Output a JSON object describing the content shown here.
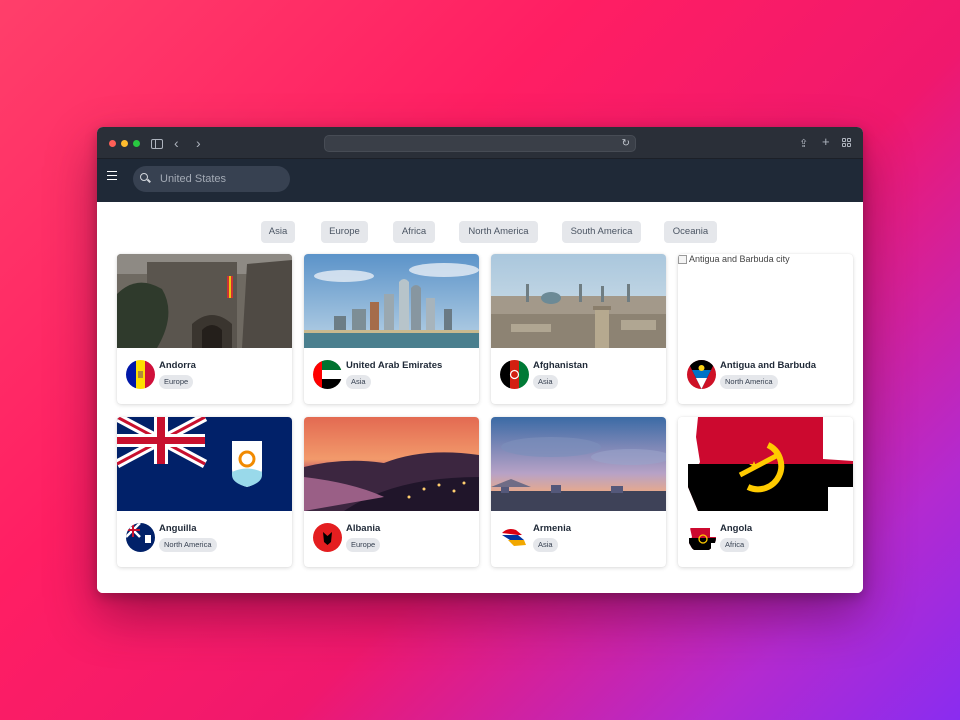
{
  "browser": {
    "url": ""
  },
  "search": {
    "placeholder": "United States"
  },
  "filters": [
    "Asia",
    "Europe",
    "Africa",
    "North America",
    "South America",
    "Oceania"
  ],
  "countries": [
    {
      "name": "Andorra",
      "region": "Europe"
    },
    {
      "name": "United Arab Emirates",
      "region": "Asia"
    },
    {
      "name": "Afghanistan",
      "region": "Asia"
    },
    {
      "name": "Antigua and Barbuda",
      "region": "North America",
      "image_alt": "Antigua and Barbuda city"
    },
    {
      "name": "Anguilla",
      "region": "North America"
    },
    {
      "name": "Albania",
      "region": "Europe"
    },
    {
      "name": "Armenia",
      "region": "Asia"
    },
    {
      "name": "Angola",
      "region": "Africa"
    }
  ],
  "colors": {
    "appbar": "#1f2937",
    "chip": "#e5e7eb",
    "titlebar": "#2a2f38"
  }
}
